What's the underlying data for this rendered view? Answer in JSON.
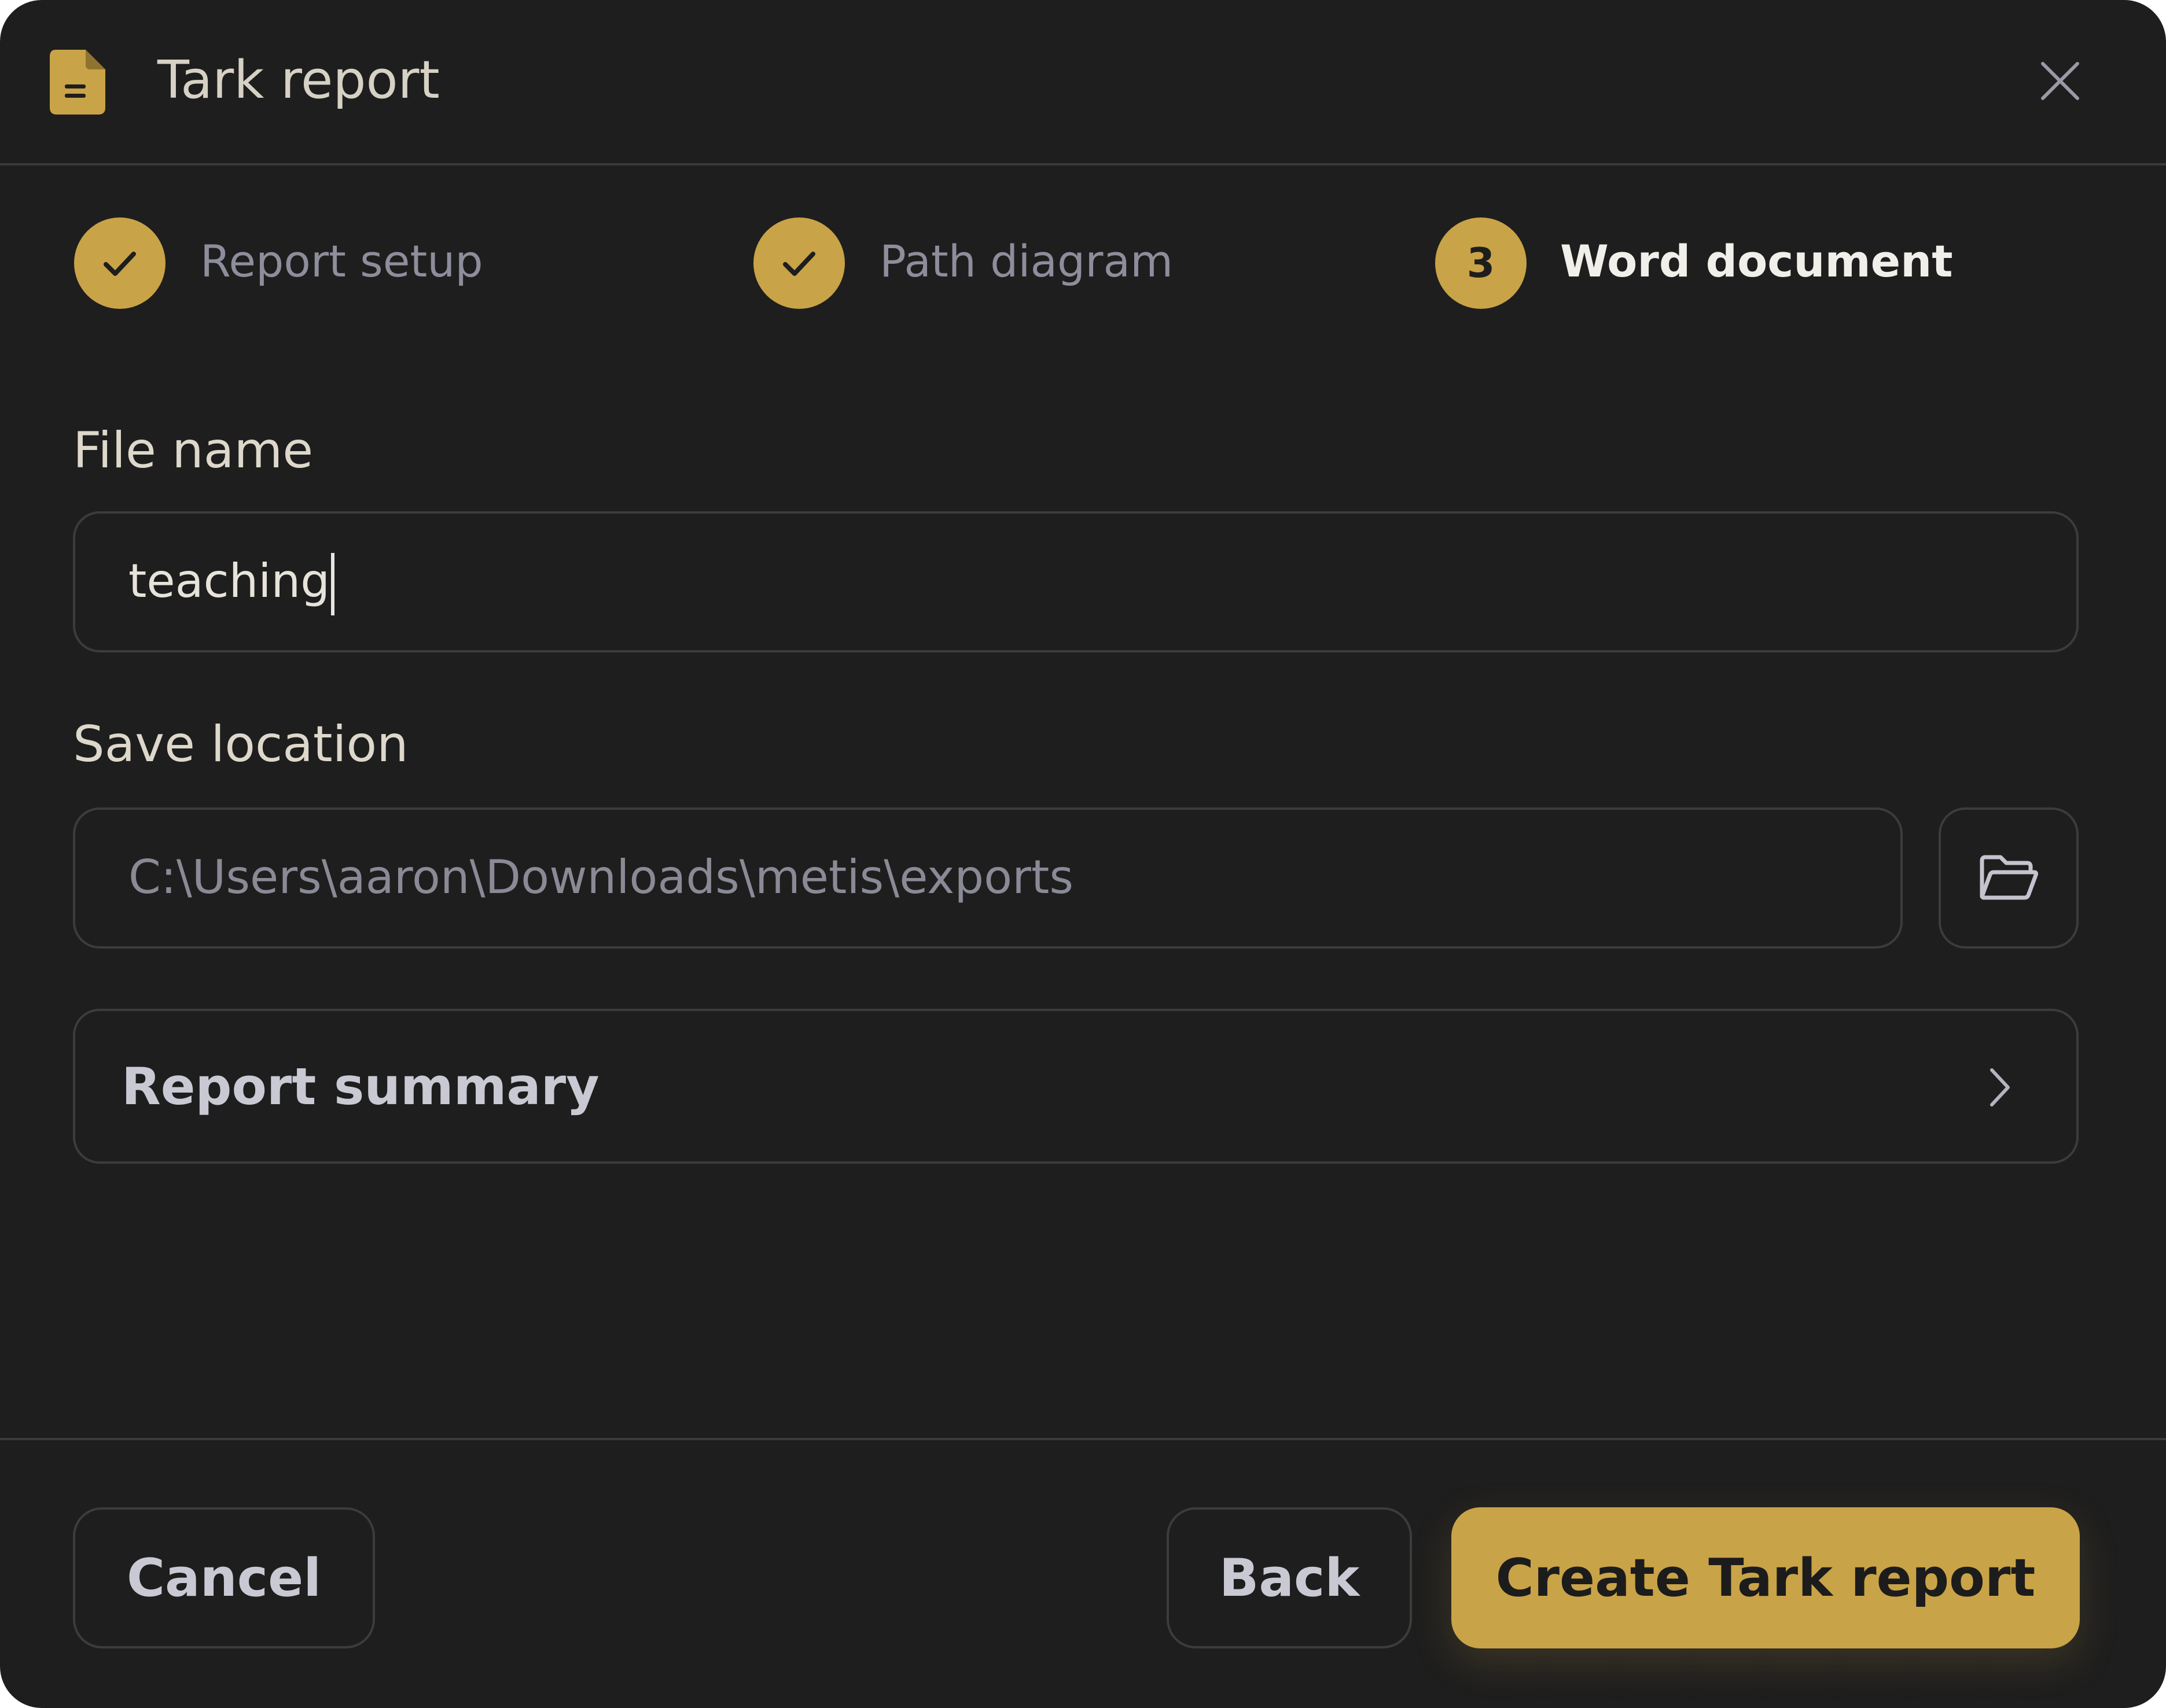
{
  "colors": {
    "accent": "#c9a347",
    "background": "#1e1e1e",
    "border": "#3c3c3c",
    "muted_text": "#8d8d9b"
  },
  "header": {
    "title": "Tark report",
    "icon": "document-icon",
    "close_icon": "close-icon"
  },
  "steps": [
    {
      "label": "Report setup",
      "status": "completed",
      "marker": "check-icon"
    },
    {
      "label": "Path diagram",
      "status": "completed",
      "marker": "check-icon"
    },
    {
      "label": "Word document",
      "status": "active",
      "number": "3"
    }
  ],
  "form": {
    "file_name": {
      "label": "File name",
      "value": "teaching"
    },
    "save_location": {
      "label": "Save location",
      "value": "C:\\Users\\aaron\\Downloads\\metis\\exports",
      "browse_icon": "folder-open-icon"
    },
    "summary": {
      "label": "Report summary",
      "icon": "chevron-right-icon"
    }
  },
  "footer": {
    "cancel_label": "Cancel",
    "back_label": "Back",
    "create_label": "Create Tark report"
  }
}
